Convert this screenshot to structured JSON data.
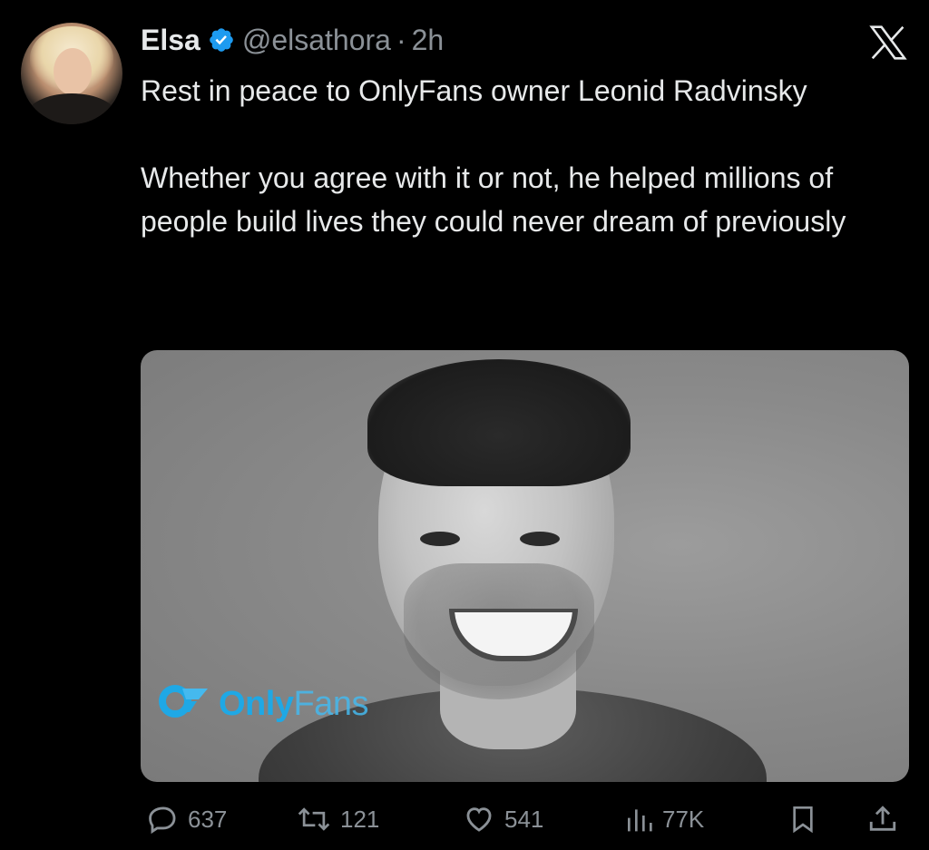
{
  "author": {
    "name": "Elsa",
    "handle": "@elsathora",
    "separator": "·",
    "time": "2h",
    "verified": true
  },
  "tweet": {
    "text": "Rest in peace to OnlyFans owner Leonid Radvinsky\n\nWhether you agree with it or not, he helped millions of people build lives they could never dream of previously"
  },
  "media": {
    "brand_only": "Only",
    "brand_fans": "Fans"
  },
  "actions": {
    "replies": "637",
    "reposts": "121",
    "likes": "541",
    "views": "77K"
  },
  "colors": {
    "background": "#000000",
    "text": "#e7e9ea",
    "muted": "#8b9197",
    "verified": "#1d9bf0",
    "brand": "#1fa8e5"
  },
  "icons": {
    "platform": "x-logo-icon",
    "verified": "verified-badge-icon",
    "reply": "reply-icon",
    "repost": "repost-icon",
    "like": "heart-icon",
    "views": "views-chart-icon",
    "bookmark": "bookmark-icon",
    "share": "share-icon"
  }
}
